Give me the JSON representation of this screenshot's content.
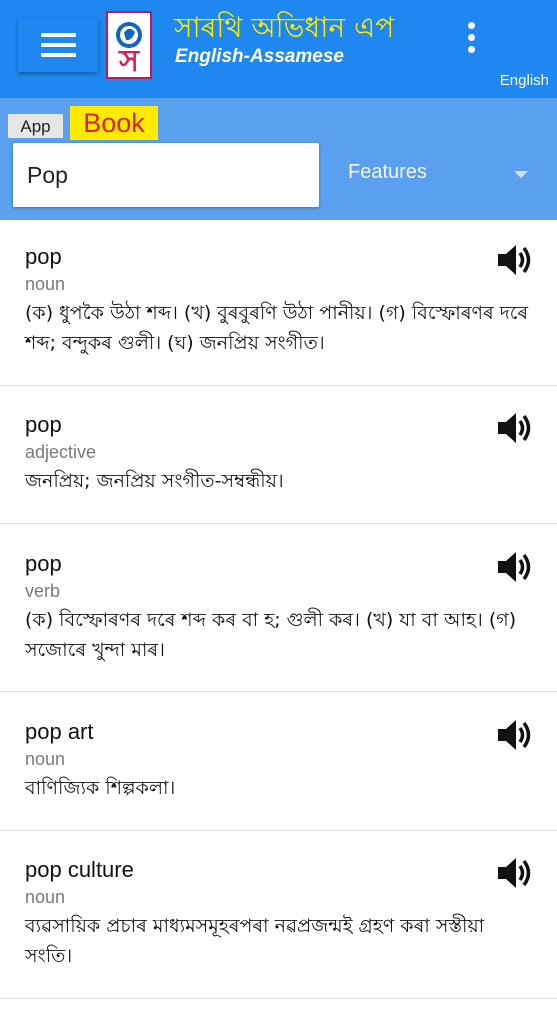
{
  "app": {
    "title": "সাৰথি অভিধান এপ",
    "subtitle": "English-Assamese",
    "language": "English",
    "logo_letter": "স"
  },
  "tabs": {
    "app_label": "App",
    "book_label": "Book"
  },
  "search": {
    "value": "Pop"
  },
  "features": {
    "label": "Features"
  },
  "entries": [
    {
      "word": "pop",
      "pos": "noun",
      "definition": "(ক) ধুপকৈ উঠা শব্দ। (খ) বুৰবুৰণি উঠা পানীয়। (গ) বিস্ফোৰণৰ দৰে শব্দ; বন্দুকৰ গুলী। (ঘ) জনপ্রিয় সংগীত।"
    },
    {
      "word": "pop",
      "pos": "adjective",
      "definition": "জনপ্রিয়; জনপ্রিয় সংগীত-সম্বন্ধীয়।"
    },
    {
      "word": "pop",
      "pos": "verb",
      "definition": "(ক) বিস্ফোৰণৰ দৰে শব্দ কৰ বা হ; গুলী কৰ। (খ) যা বা আহ। (গ) সজোৰে খুন্দা মাৰ।"
    },
    {
      "word": "pop art",
      "pos": "noun",
      "definition": "বাণিজ্যিক শিল্পকলা।"
    },
    {
      "word": "pop culture",
      "pos": "noun",
      "definition": "ব্যৱসায়িক প্রচাৰ মাধ্যমসমূহৰপৰা নৱপ্রজন্মই গ্রহণ কৰা সস্তীয়া সংতি।"
    }
  ],
  "colors": {
    "appbar": "#1e88f0",
    "searchbar": "#5aa0ef",
    "title": "#ffeb00",
    "book_tab_bg": "#ffeb00",
    "book_tab_text": "#e02020"
  },
  "icons": {
    "menu": "menu-icon",
    "overflow": "more-vert-icon",
    "speaker": "volume-up-icon",
    "dropdown": "dropdown-arrow-icon"
  }
}
